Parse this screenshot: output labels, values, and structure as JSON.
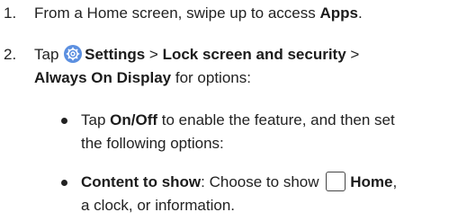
{
  "steps": [
    {
      "number": "1.",
      "text_a": "From a Home screen, swipe up to access ",
      "bold_a": "Apps",
      "text_b": "."
    },
    {
      "number": "2.",
      "text_a": "Tap ",
      "icon": "settings-gear-icon",
      "bold_a": "Settings",
      "sep_a": " > ",
      "bold_b": "Lock screen and security",
      "sep_b": " >",
      "bold_c": "Always On Display",
      "text_c": " for options:"
    }
  ],
  "bullets": [
    {
      "text_a": "Tap ",
      "bold_a": "On/Off",
      "text_b": " to enable the feature, and then set",
      "text_c": "the following options:"
    },
    {
      "bold_a": "Content to show",
      "text_a": ": Choose to show ",
      "icon": "home-key-icon",
      "bold_b": "Home",
      "text_b": ",",
      "text_c": "a clock, or information."
    }
  ],
  "colors": {
    "text": "#222222",
    "settings_icon": "#5b8fe0"
  }
}
